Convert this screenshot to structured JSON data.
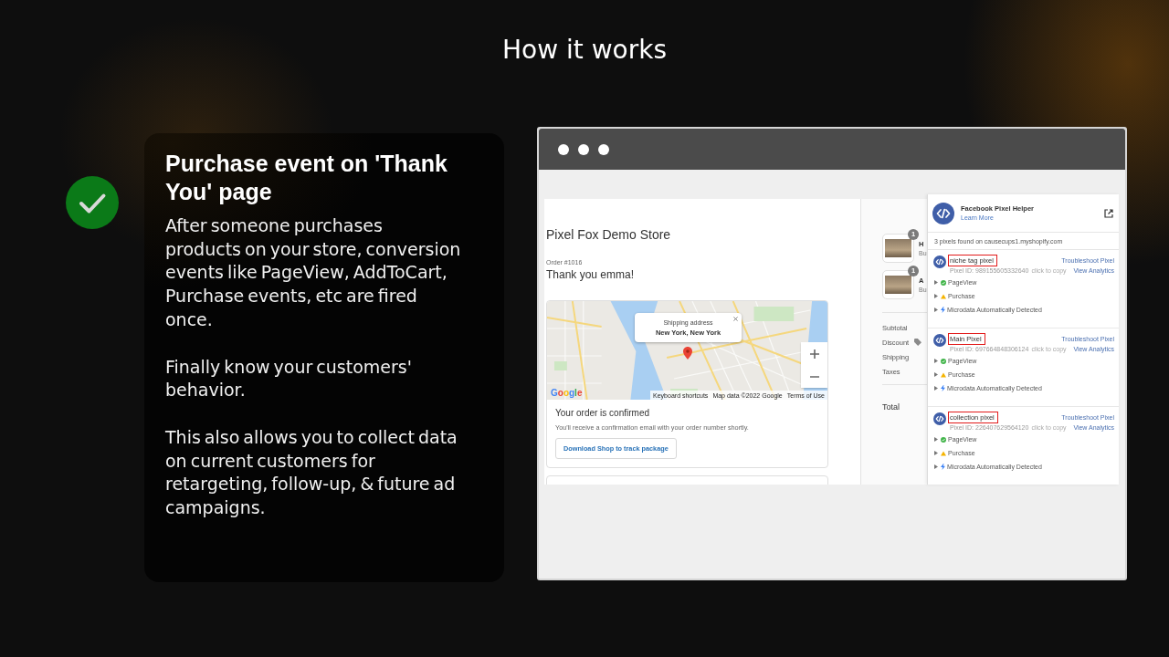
{
  "header": {
    "title": "How it works"
  },
  "feature": {
    "title": "Purchase event on 'Thank You' page",
    "paragraphs": [
      "After someone purchases products on your store, conversion events like PageView, AddToCart, Purchase events, etc are fired once.",
      "Finally know your customers' behavior.",
      "This also allows you to collect data on current customers for retargeting, follow-up, & future ad campaigns."
    ]
  },
  "browser": {
    "store": {
      "name": "Pixel Fox Demo Store",
      "order_number": "Order #1016",
      "greeting": "Thank you emma!",
      "map": {
        "popup": {
          "label": "Shipping address",
          "address": "New York, New York"
        },
        "logo": "Google",
        "attribution": [
          "Keyboard shortcuts",
          "Map data ©2022 Google",
          "Terms of Use"
        ]
      },
      "confirmation": {
        "title": "Your order is confirmed",
        "text": "You'll receive a confirmation email with your order number shortly.",
        "button": "Download Shop to track package"
      }
    },
    "summary": {
      "items": [
        {
          "quantity": "1",
          "name": "H",
          "variant": "Bu"
        },
        {
          "quantity": "1",
          "name": "A",
          "variant": "Bu"
        }
      ],
      "lines": [
        {
          "label": "Subtotal",
          "kind": "plain"
        },
        {
          "label": "Discount",
          "kind": "discount"
        },
        {
          "label": "Shipping",
          "kind": "plain"
        },
        {
          "label": "Taxes",
          "kind": "plain"
        }
      ],
      "total": "Total"
    },
    "pixel_helper": {
      "title": "Facebook Pixel Helper",
      "link": "Learn More",
      "summary": "3 pixels found on causecups1.myshopify.com",
      "pixels": [
        {
          "name": "niche tag pixel",
          "highlighted": true,
          "pixel_id": "Pixel ID: 989155605332640",
          "copy_hint": "click to copy",
          "links": [
            "Troubleshoot Pixel",
            "View Analytics"
          ],
          "events": [
            {
              "kind": "success",
              "label": "PageView",
              "expanded": false
            },
            {
              "kind": "warning",
              "label": "Purchase",
              "expanded": false
            },
            {
              "kind": "info",
              "label": "Microdata Automatically Detected",
              "expanded": false
            }
          ]
        },
        {
          "name": "Main Pixel",
          "highlighted": true,
          "pixel_id": "Pixel ID: 697664848306124",
          "copy_hint": "click to copy",
          "links": [
            "Troubleshoot Pixel",
            "View Analytics"
          ],
          "events": [
            {
              "kind": "success",
              "label": "PageView",
              "expanded": false
            },
            {
              "kind": "warning",
              "label": "Purchase",
              "expanded": false
            },
            {
              "kind": "info",
              "label": "Microdata Automatically Detected",
              "expanded": false
            }
          ]
        },
        {
          "name": "collection pixel",
          "highlighted": true,
          "pixel_id": "Pixel ID: 226407629564120",
          "copy_hint": "click to copy",
          "links": [
            "Troubleshoot Pixel",
            "View Analytics"
          ],
          "events": [
            {
              "kind": "success",
              "label": "PageView",
              "expanded": false
            },
            {
              "kind": "warning",
              "label": "Purchase",
              "expanded": false
            },
            {
              "kind": "info",
              "label": "Microdata Automatically Detected",
              "expanded": false
            }
          ]
        }
      ]
    }
  }
}
